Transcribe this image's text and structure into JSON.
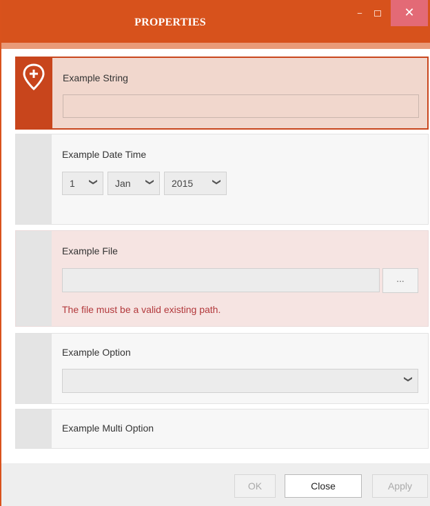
{
  "window": {
    "title": "PROPERTIES",
    "minimize_glyph": "–",
    "close_glyph": "✕",
    "accent_color": "#d7521c"
  },
  "properties": {
    "string": {
      "label": "Example String",
      "value": ""
    },
    "datetime": {
      "label": "Example Date Time",
      "day": "1",
      "month": "Jan",
      "year": "2015"
    },
    "file": {
      "label": "Example File",
      "value": "",
      "browse_label": "...",
      "error": "The file must be a valid existing path."
    },
    "option": {
      "label": "Example Option",
      "selected": ""
    },
    "multi_option": {
      "label": "Example Multi Option"
    }
  },
  "footer": {
    "ok_label": "OK",
    "close_label": "Close",
    "apply_label": "Apply"
  }
}
